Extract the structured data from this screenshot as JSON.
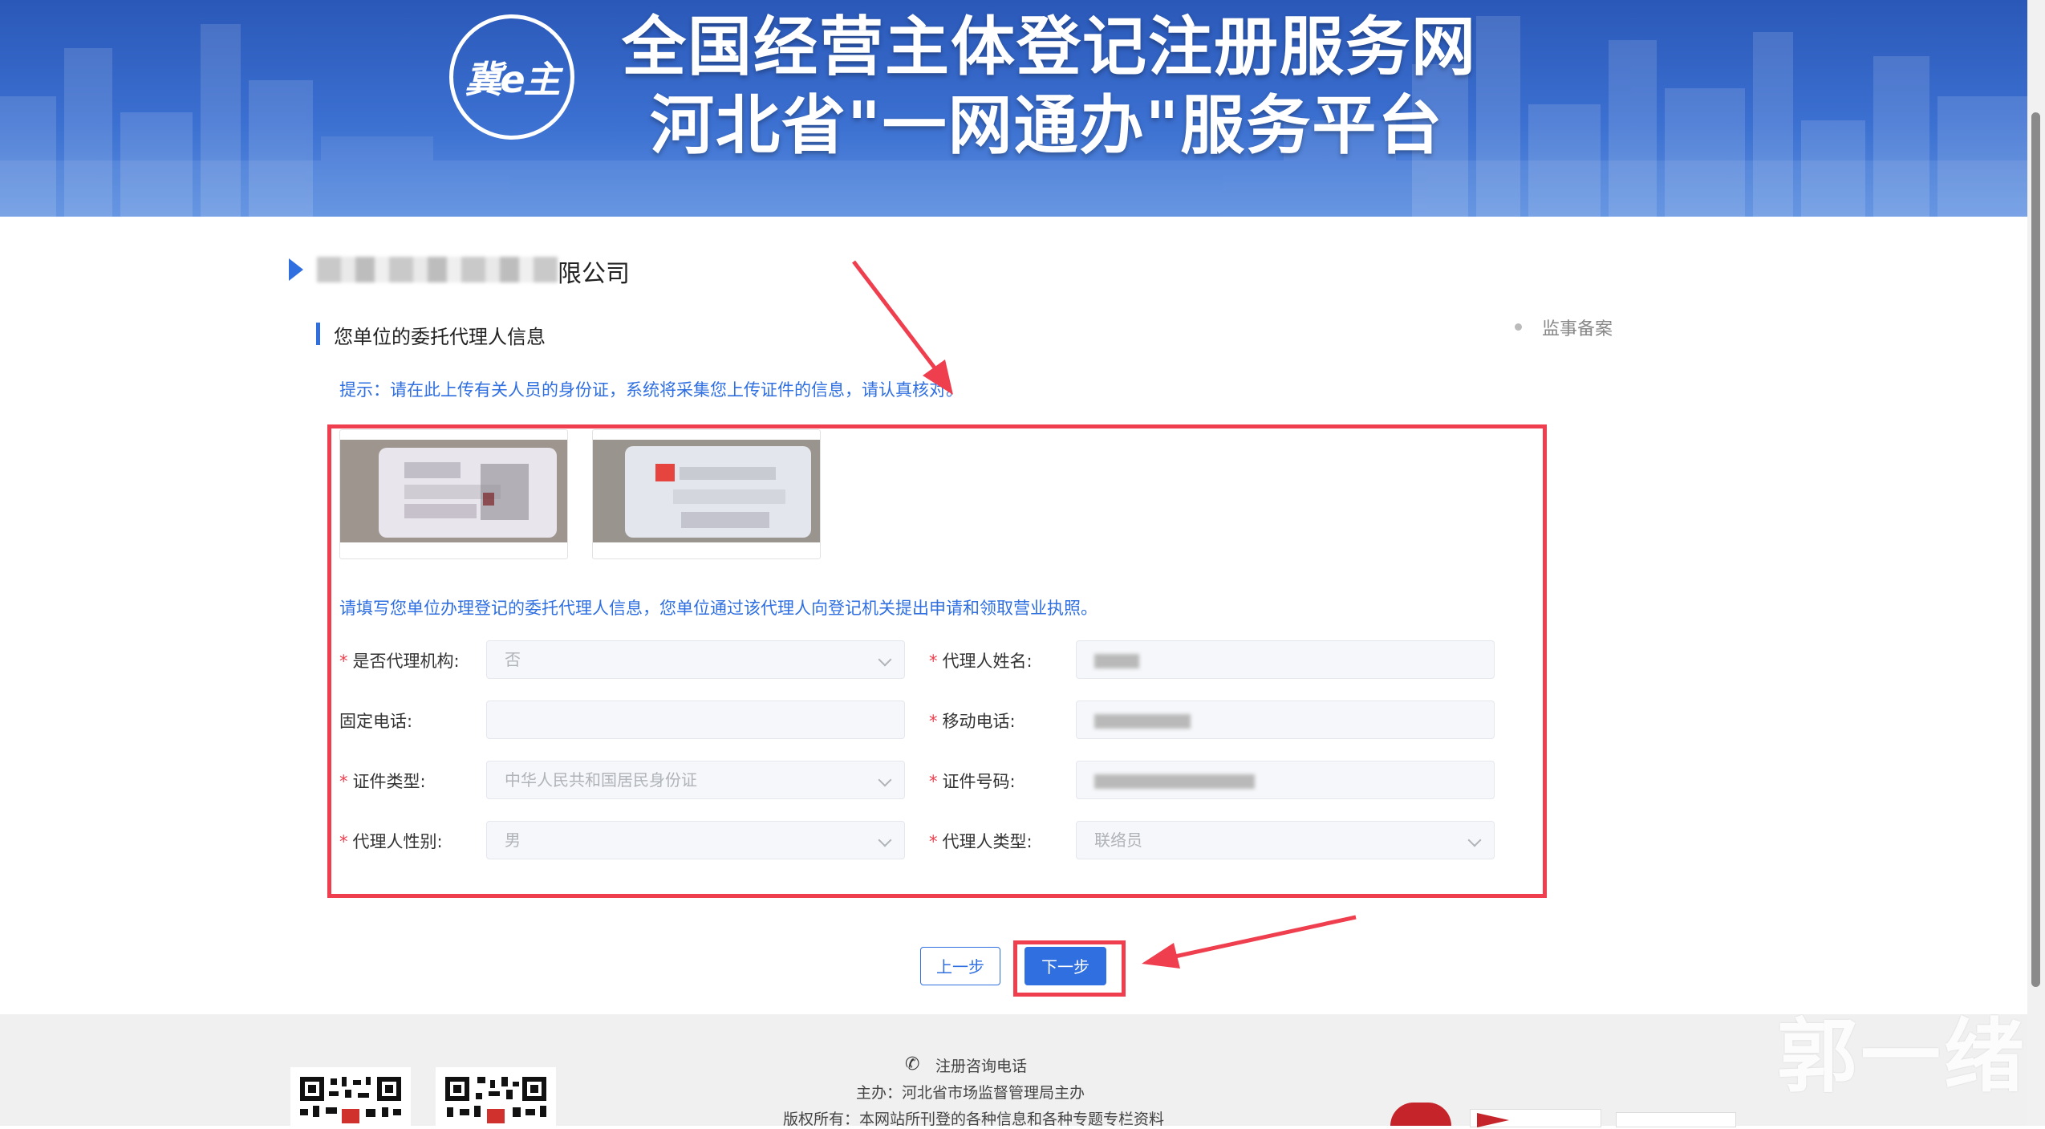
{
  "header": {
    "logo_text": "冀e主",
    "title_line1": "全国经营主体登记注册服务网",
    "title_line2": "河北省\"一网通办\"服务平台"
  },
  "company": {
    "name_suffix": "限公司"
  },
  "section": {
    "title": "您单位的委托代理人信息"
  },
  "side_nav": {
    "item": "监事备案"
  },
  "upload_hint": "提示：请在此上传有关人员的身份证，系统将采集您上传证件的信息，请认真核对。",
  "form_desc": "请填写您单位办理登记的委托代理人信息，您单位通过该代理人向登记机关提出申请和领取营业执照。",
  "form": {
    "is_agency_label": "是否代理机构:",
    "is_agency_value": "否",
    "agent_name_label": "代理人姓名:",
    "landline_label": "固定电话:",
    "mobile_label": "移动电话:",
    "id_type_label": "证件类型:",
    "id_type_value": "中华人民共和国居民身份证",
    "id_number_label": "证件号码:",
    "gender_label": "代理人性别:",
    "gender_value": "男",
    "agent_type_label": "代理人类型:",
    "agent_type_value": "联络员"
  },
  "buttons": {
    "prev": "上一步",
    "next": "下一步"
  },
  "footer": {
    "phone_label": "注册咨询电话",
    "host": "主办：河北省市场监督管理局主办",
    "copyright": "版权所有：本网站所刊登的各种信息和各种专题专栏资料"
  },
  "watermark": "郭一绪",
  "colors": {
    "primary": "#2f6fe0",
    "annotation_red": "#ef3f4e",
    "banner": "#3b6fd0"
  }
}
